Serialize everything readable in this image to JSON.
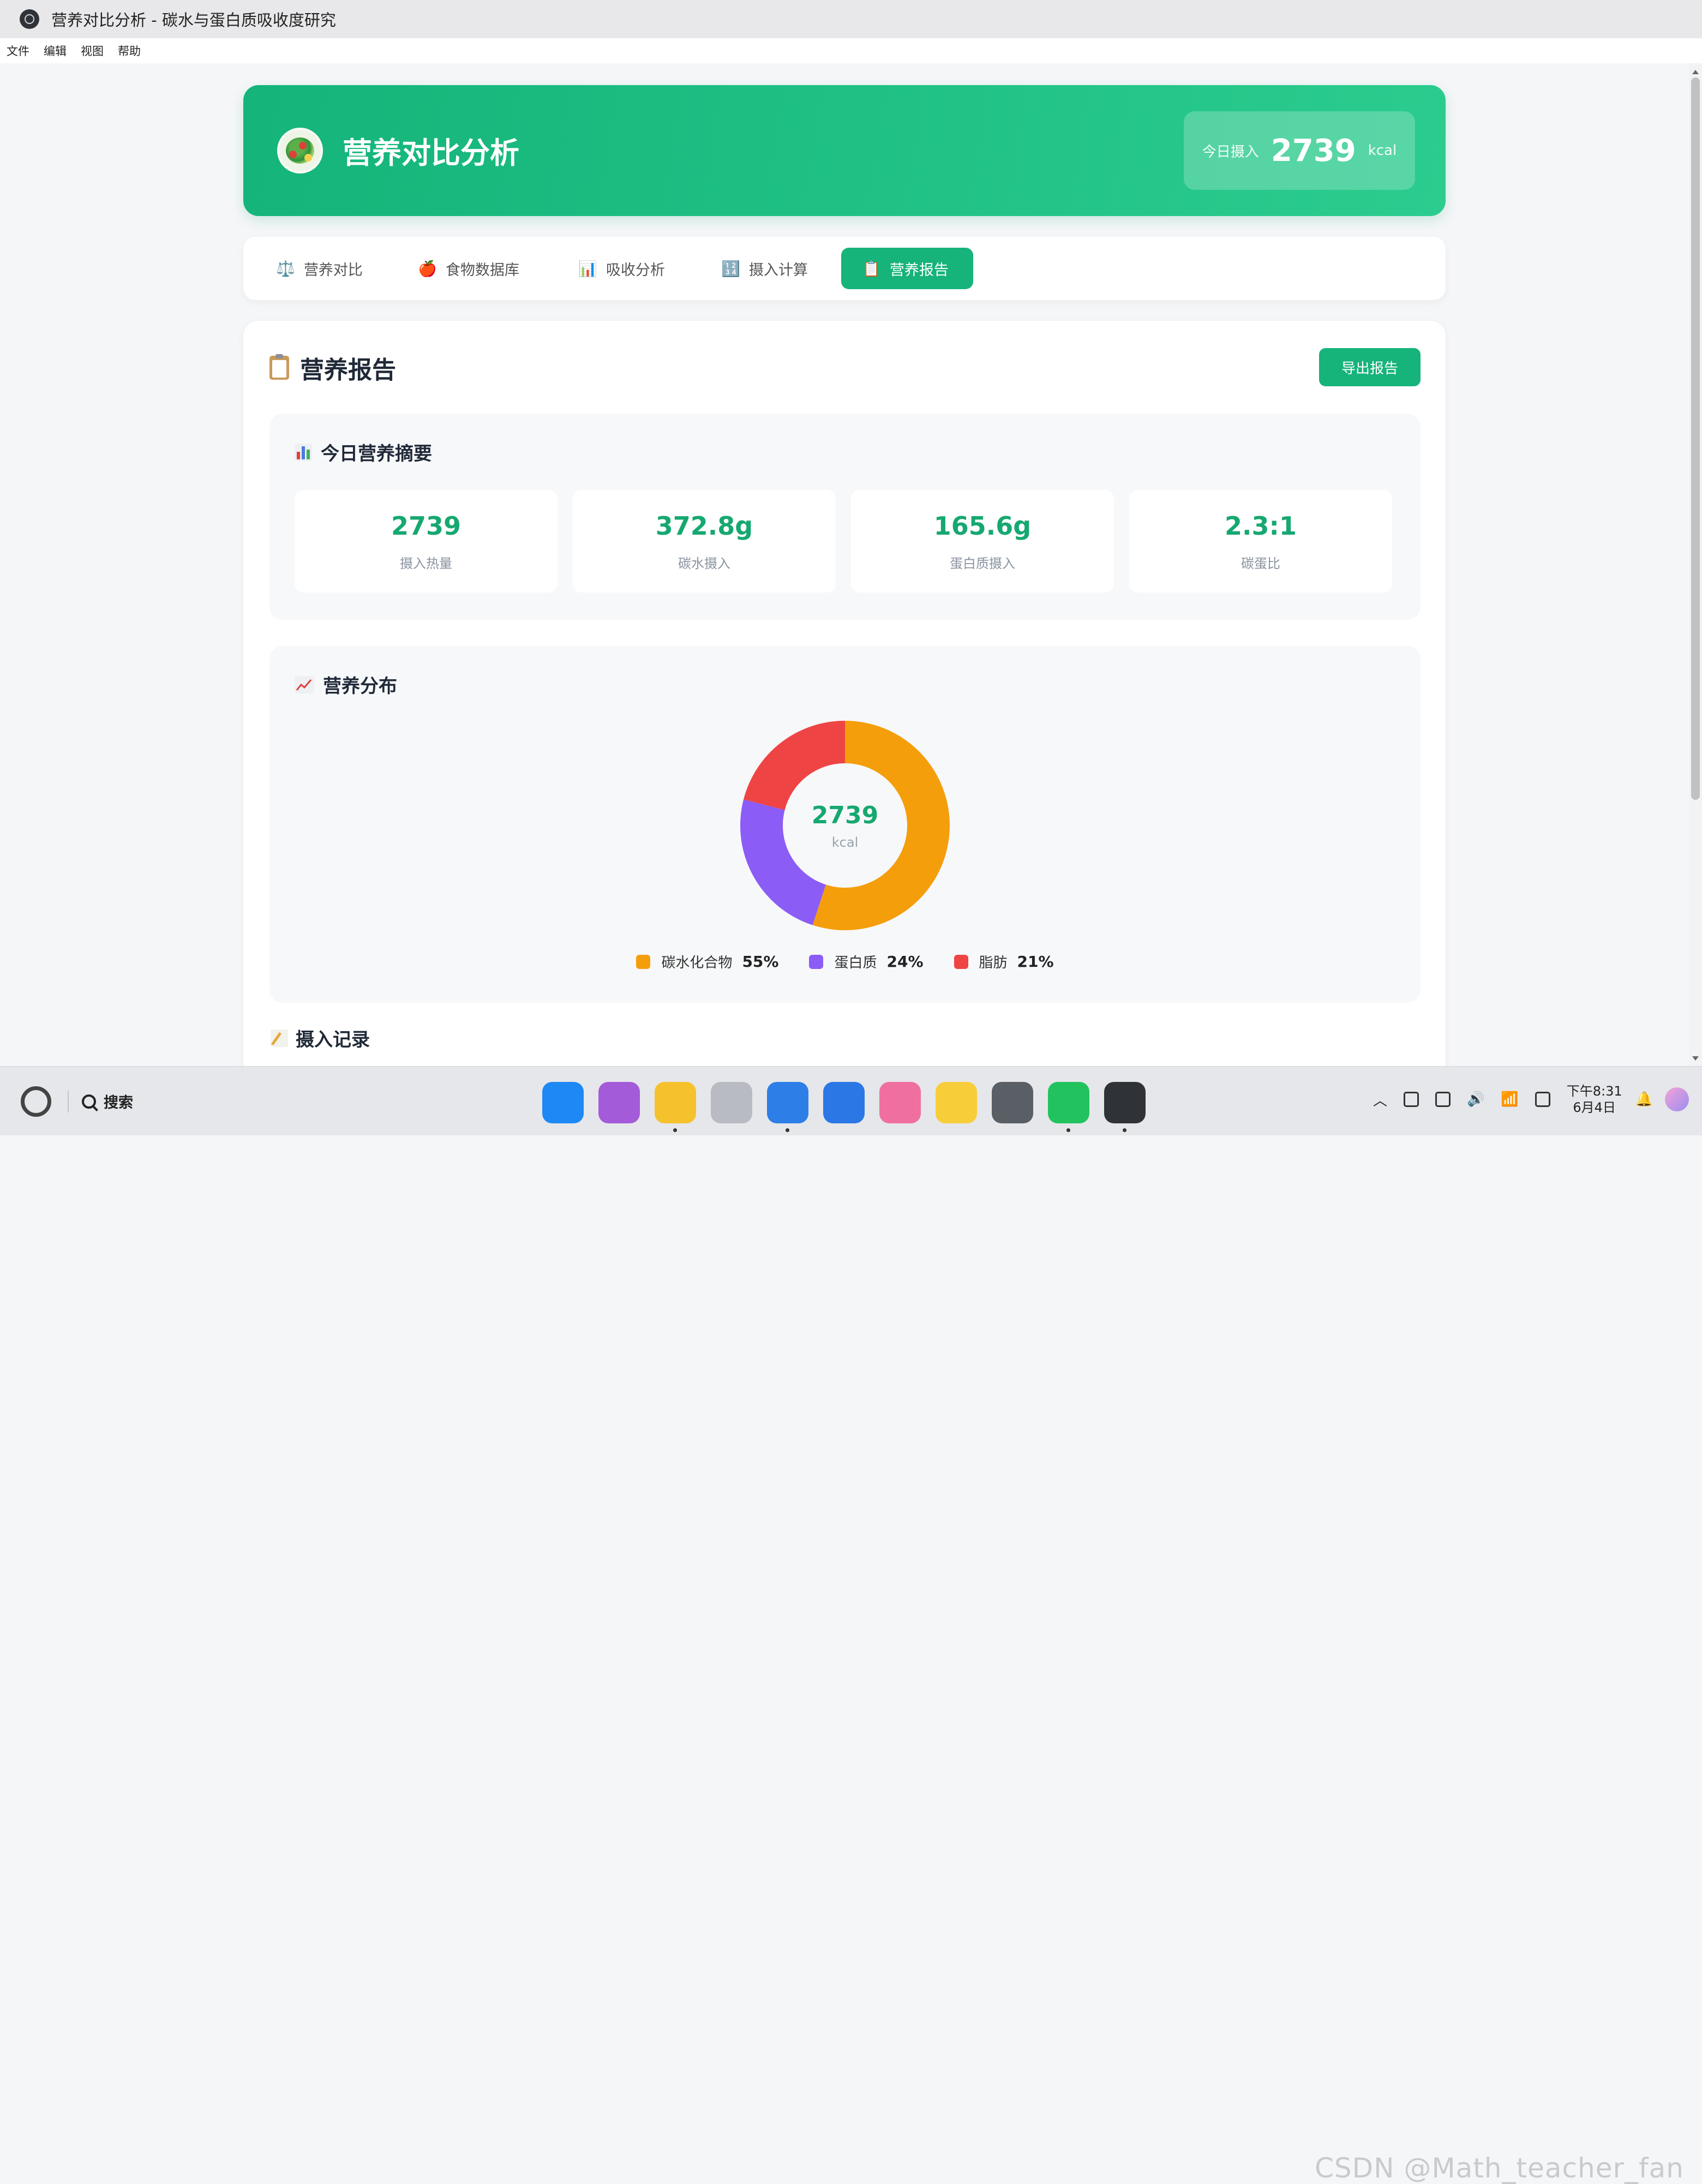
{
  "window": {
    "title": "营养对比分析 - 碳水与蛋白质吸收度研究",
    "menu": [
      "文件",
      "编辑",
      "视图",
      "帮助"
    ]
  },
  "header": {
    "title": "营养对比分析",
    "intake_label": "今日摄入",
    "intake_value": "2739",
    "intake_unit": "kcal"
  },
  "tabs": [
    {
      "label": "营养对比",
      "icon": "⚖️",
      "icon_name": "scale-icon"
    },
    {
      "label": "食物数据库",
      "icon": "🍎",
      "icon_name": "apple-icon"
    },
    {
      "label": "吸收分析",
      "icon": "📊",
      "icon_name": "bar-chart-icon"
    },
    {
      "label": "摄入计算",
      "icon": "🔢",
      "icon_name": "numbers-icon"
    },
    {
      "label": "营养报告",
      "icon": "📋",
      "icon_name": "clipboard-icon",
      "active": true
    }
  ],
  "report": {
    "title": "营养报告",
    "export_label": "导出报告",
    "summary": {
      "title": "今日营养摘要",
      "stats": [
        {
          "value": "2739",
          "label": "摄入热量"
        },
        {
          "value": "372.8g",
          "label": "碳水摄入"
        },
        {
          "value": "165.6g",
          "label": "蛋白质摄入"
        },
        {
          "value": "2.3:1",
          "label": "碳蛋比"
        }
      ]
    },
    "distribution": {
      "title": "营养分布",
      "center_value": "2739",
      "center_unit": "kcal",
      "legend": [
        {
          "name": "碳水化合物",
          "pct": "55%"
        },
        {
          "name": "蛋白质",
          "pct": "24%"
        },
        {
          "name": "脂肪",
          "pct": "21%"
        }
      ]
    },
    "records_title": "摄入记录"
  },
  "chart_data": {
    "type": "pie",
    "donut": true,
    "categories": [
      "碳水化合物",
      "蛋白质",
      "脂肪"
    ],
    "values": [
      55,
      24,
      21
    ],
    "colors": [
      "#f59e0b",
      "#8b5cf6",
      "#ef4444"
    ],
    "center_label": "2739",
    "center_sublabel": "kcal"
  },
  "taskbar": {
    "search_label": "搜索",
    "apps": [
      {
        "name": "launcher-icon",
        "color": "#1e88f5",
        "running": false
      },
      {
        "name": "multitask-icon",
        "color": "#a45bd9",
        "running": false
      },
      {
        "name": "files-icon",
        "color": "#f5c22e",
        "running": true
      },
      {
        "name": "trash-icon",
        "color": "#b8bcc2",
        "running": false
      },
      {
        "name": "browser-icon",
        "color": "#2e7ee8",
        "running": true
      },
      {
        "name": "mail-icon",
        "color": "#2b77e6",
        "running": false
      },
      {
        "name": "photos-icon",
        "color": "#f06fa1",
        "running": false
      },
      {
        "name": "notes-icon",
        "color": "#f7cd3a",
        "running": false
      },
      {
        "name": "settings-icon",
        "color": "#5a5f66",
        "running": false
      },
      {
        "name": "wechat-icon",
        "color": "#22c35e",
        "running": true
      },
      {
        "name": "electron-app-icon",
        "color": "#2f3338",
        "running": true
      }
    ],
    "clock_time": "下午8:31",
    "clock_date": "6月4日",
    "watermark": "CSDN @Math_teacher_fan"
  }
}
